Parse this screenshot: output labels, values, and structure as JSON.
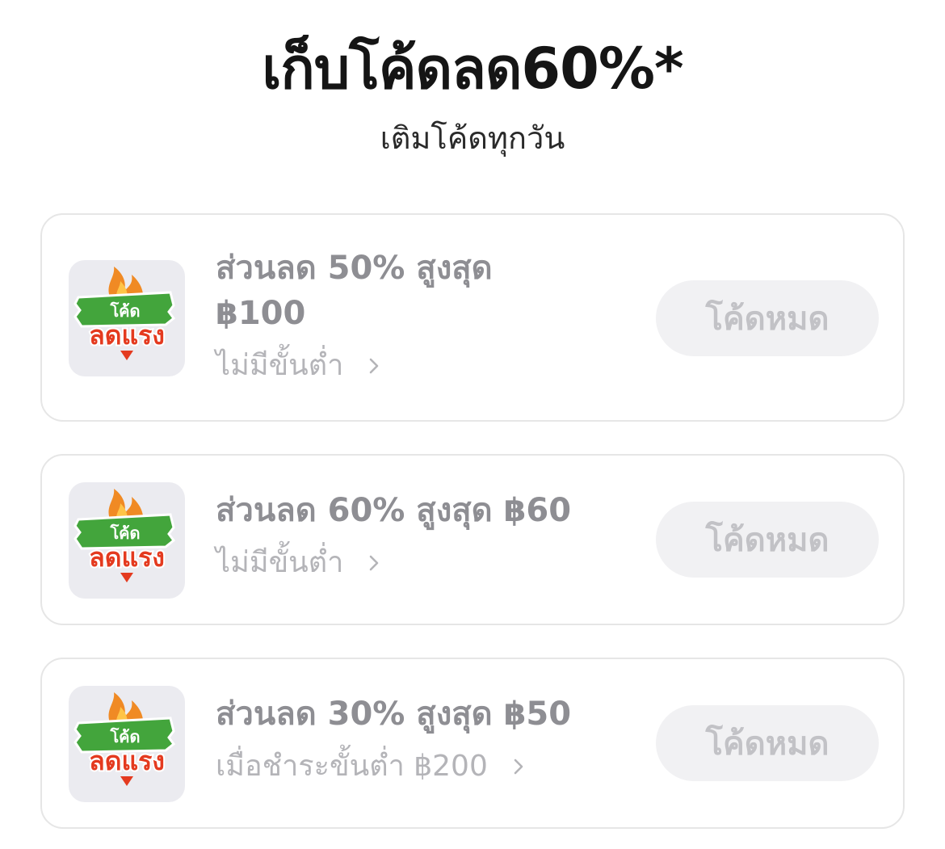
{
  "header": {
    "title": "เก็บโค้ดลด60%*",
    "subtitle": "เติมโค้ดทุกวัน"
  },
  "coupons": [
    {
      "badge_top": "โค้ด",
      "badge_bottom": "ลดแรง",
      "offer_line1": "ส่วนลด 50% สูงสุด",
      "offer_line2": "฿100",
      "condition": "ไม่มีขั้นต่ำ",
      "button": "โค้ดหมด"
    },
    {
      "badge_top": "โค้ด",
      "badge_bottom": "ลดแรง",
      "offer_line1": "ส่วนลด 60% สูงสุด ฿60",
      "condition": "ไม่มีขั้นต่ำ",
      "button": "โค้ดหมด"
    },
    {
      "badge_top": "โค้ด",
      "badge_bottom": "ลดแรง",
      "offer_line1": "ส่วนลด 30% สูงสุด ฿50",
      "condition": "เมื่อชำระขั้นต่ำ ฿200",
      "button": "โค้ดหมด"
    }
  ],
  "icons": {
    "coupon_badge": "flame-discount-badge-icon",
    "condition_chevron": "chevron-right-icon"
  },
  "colors": {
    "title": "#151515",
    "offer_text": "#8e8e93",
    "condition_text": "#b4b4b8",
    "button_bg": "#f1f1f3",
    "button_text": "#c2c2c6",
    "card_border": "#e6e6e6",
    "badge_green": "#43a53c",
    "badge_red": "#e43a1f",
    "flame": "#f08a24"
  }
}
